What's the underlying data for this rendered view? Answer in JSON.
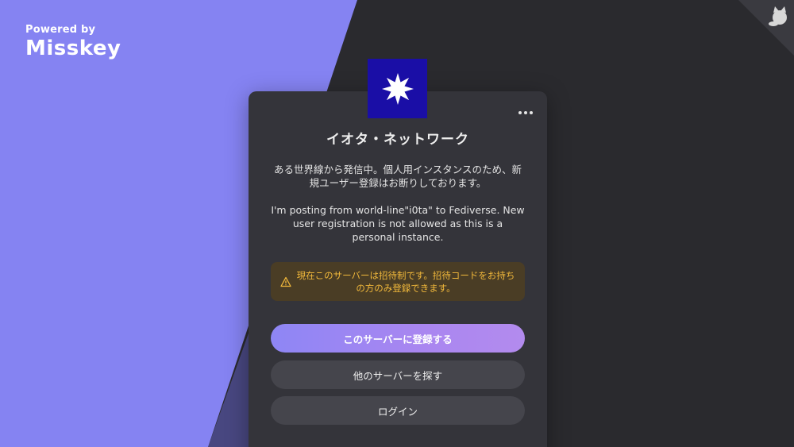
{
  "powered": {
    "label": "Powered by",
    "brand": "Misskey"
  },
  "instance": {
    "name": "イオタ・ネットワーク",
    "description_ja": "ある世界線から発信中。個人用インスタンスのため、新規ユーザー登録はお断りしております。",
    "description_en": "I'm posting from world-line\"i0ta\" to Fediverse. New user registration is not allowed as this is a personal instance.",
    "icon": "eight-point-star-icon"
  },
  "warning": {
    "text": "現在このサーバーは招待制です。招待コードをお持ちの方のみ登録できます。",
    "icon": "warning-triangle-icon"
  },
  "buttons": {
    "register": "このサーバーに登録する",
    "find_server": "他のサーバーを探す",
    "login": "ログイン"
  },
  "icons": {
    "more": "more-dots-icon",
    "corner": "cat-logo-icon"
  },
  "colors": {
    "accent": "#8583f2",
    "background": "#2a2a2e",
    "card": "#34343a",
    "instance_icon_bg": "#1a0ea6",
    "warning_text": "#f2b93b",
    "warning_bg": "#4a3d25"
  }
}
